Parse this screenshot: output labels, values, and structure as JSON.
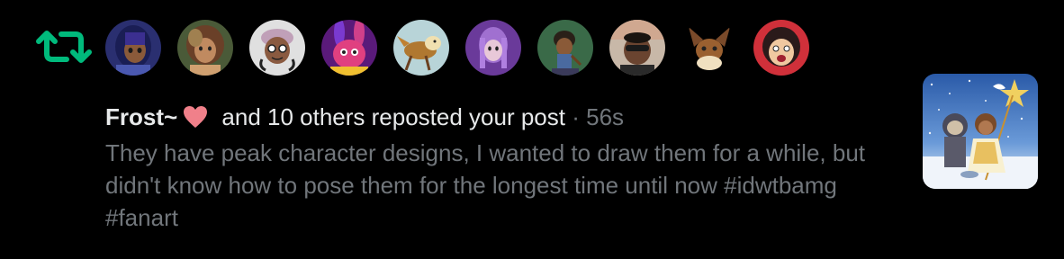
{
  "notification": {
    "type_icon": "repost-icon",
    "avatars": [
      {
        "icon": "avatar-1",
        "color": "#3a3f8f"
      },
      {
        "icon": "avatar-2",
        "color": "#5a6a3a"
      },
      {
        "icon": "avatar-3",
        "color": "#d8d8d8"
      },
      {
        "icon": "avatar-4",
        "color": "#8a2a9a"
      },
      {
        "icon": "avatar-5",
        "color": "#a5c4c8"
      },
      {
        "icon": "avatar-6",
        "color": "#7a4aa8"
      },
      {
        "icon": "avatar-7",
        "color": "#3d6a4a"
      },
      {
        "icon": "avatar-8",
        "color": "#b89a80"
      },
      {
        "icon": "avatar-9",
        "color": "#000000"
      },
      {
        "icon": "avatar-10",
        "color": "#c0303a"
      }
    ],
    "actor_name": "Frost~",
    "actor_emoji": "heart",
    "action_text": " and 10 others reposted your post",
    "separator": " · ",
    "time": "56s",
    "post_text": "They have peak character designs, I wanted to draw them for a while, but didn't know how to pose them for the longest time until now #idwtbamg #fanart"
  },
  "colors": {
    "background": "#000000",
    "repost_green": "#00ba7c",
    "primary_text": "#e7e9ea",
    "secondary_text": "#71767b",
    "heart": "#f0808a"
  }
}
